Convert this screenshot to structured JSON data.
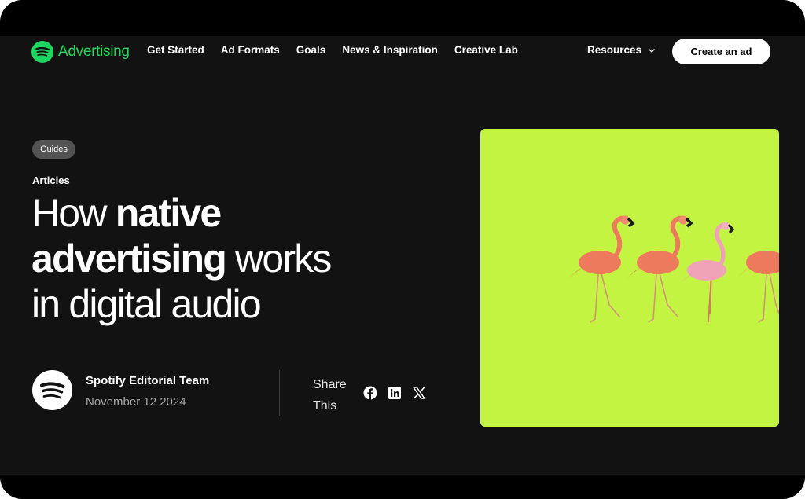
{
  "header": {
    "brand": "Advertising",
    "nav": [
      "Get Started",
      "Ad Formats",
      "Goals",
      "News & Inspiration",
      "Creative Lab"
    ],
    "resources": "Resources",
    "cta": "Create an ad"
  },
  "article": {
    "tag": "Guides",
    "category": "Articles",
    "headline": {
      "part1": "How ",
      "bold1": "native",
      "bold2": "advertising",
      "part2": " works",
      "line3": "in digital audio"
    },
    "author": "Spotify Editorial Team",
    "date": "November 12 2024",
    "share_label": "Share This"
  },
  "icons": {
    "brand": "spotify-logo-icon",
    "resources": "chevron-down-icon",
    "avatar": "spotify-logo-icon",
    "share": [
      "facebook-icon",
      "linkedin-icon",
      "x-icon"
    ],
    "hero": "flamingo-image"
  },
  "colors": {
    "brand_green": "#1ed760",
    "page_background": "#121212",
    "hero_background": "#c4f442",
    "tag_background": "#535353",
    "date_text": "#a7a7a7"
  }
}
